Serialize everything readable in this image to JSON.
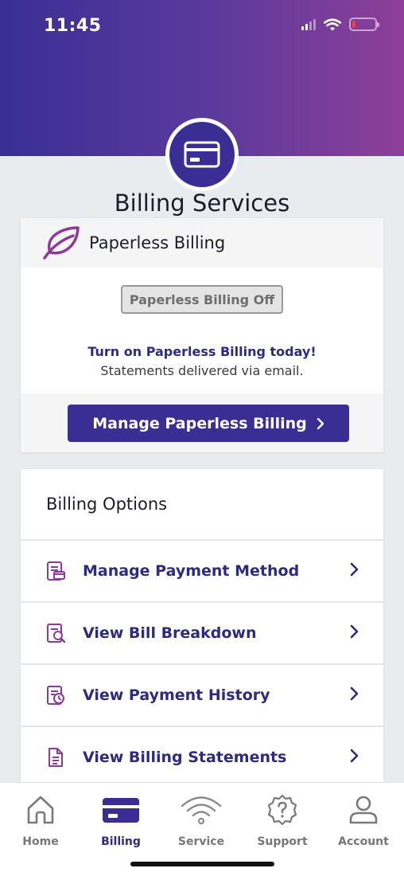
{
  "status_bar": {
    "time": "11:45"
  },
  "page": {
    "title": "Billing Services"
  },
  "paperless": {
    "header_label": "Paperless Billing",
    "status_button": "Paperless Billing Off",
    "promo_title": "Turn on Paperless Billing today!",
    "promo_subtitle": "Statements delivered via email.",
    "manage_button": "Manage Paperless Billing"
  },
  "billing_options": {
    "title": "Billing Options",
    "items": [
      {
        "label": "Manage Payment Method",
        "icon": "payment-method-icon"
      },
      {
        "label": "View Bill Breakdown",
        "icon": "bill-breakdown-icon"
      },
      {
        "label": "View Payment History",
        "icon": "payment-history-icon"
      },
      {
        "label": "View Billing Statements",
        "icon": "billing-statement-icon"
      }
    ]
  },
  "tabs": [
    {
      "label": "Home",
      "icon": "home-icon",
      "active": false
    },
    {
      "label": "Billing",
      "icon": "credit-card-icon",
      "active": true
    },
    {
      "label": "Service",
      "icon": "wifi-icon",
      "active": false
    },
    {
      "label": "Support",
      "icon": "help-icon",
      "active": false
    },
    {
      "label": "Account",
      "icon": "user-icon",
      "active": false
    }
  ],
  "colors": {
    "brand_primary": "#3a2e95",
    "header_gradient_start": "#3a2f96",
    "header_gradient_end": "#8e3f98",
    "accent_icon": "#8b3a97"
  }
}
